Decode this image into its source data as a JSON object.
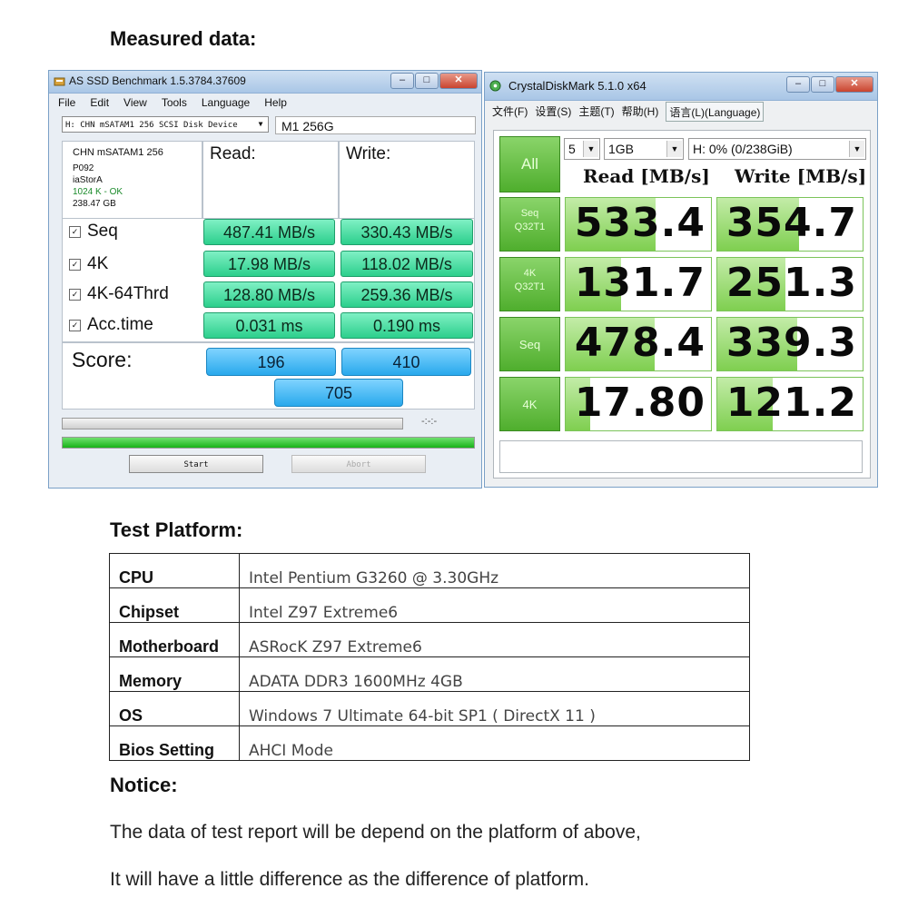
{
  "headings": {
    "measured": "Measured data:",
    "platform": "Test Platform:",
    "notice": "Notice:"
  },
  "asssd": {
    "title": "AS SSD Benchmark 1.5.3784.37609",
    "menu": [
      "File",
      "Edit",
      "View",
      "Tools",
      "Language",
      "Help"
    ],
    "drive_select": "H: CHN mSATAM1 256 SCSI Disk Device",
    "drive_name": "M1 256G",
    "info": {
      "model": "CHN mSATAM1 256",
      "firmware": "P092",
      "driver": "iaStorA",
      "align": "1024 K - OK",
      "size": "238.47 GB"
    },
    "headers": {
      "read": "Read:",
      "write": "Write:"
    },
    "rows": [
      {
        "label": "Seq",
        "read": "487.41 MB/s",
        "write": "330.43 MB/s"
      },
      {
        "label": "4K",
        "read": "17.98 MB/s",
        "write": "118.02 MB/s"
      },
      {
        "label": "4K-64Thrd",
        "read": "128.80 MB/s",
        "write": "259.36 MB/s"
      },
      {
        "label": "Acc.time",
        "read": "0.031 ms",
        "write": "0.190 ms"
      }
    ],
    "score_label": "Score:",
    "score": {
      "read": "196",
      "write": "410",
      "total": "705"
    },
    "timer": "-:-:-",
    "progress": 1.0,
    "start_label": "Start",
    "abort_label": "Abort"
  },
  "cdm": {
    "title": "CrystalDiskMark 5.1.0 x64",
    "menu": [
      "文件(F)",
      "设置(S)",
      "主题(T)",
      "帮助(H)",
      "语言(L)(Language)"
    ],
    "all_label": "All",
    "count": "5",
    "size": "1GB",
    "drive": "H: 0% (0/238GiB)",
    "headers": {
      "read": "Read [MB/s]",
      "write": "Write [MB/s]"
    },
    "rows": [
      {
        "line1": "Seq",
        "line2": "Q32T1",
        "read": "533.4",
        "write": "354.7",
        "read_level": 0.62,
        "write_level": 0.56
      },
      {
        "line1": "4K",
        "line2": "Q32T1",
        "read": "131.7",
        "write": "251.3",
        "read_level": 0.38,
        "write_level": 0.47
      },
      {
        "line1": "Seq",
        "line2": "",
        "read": "478.4",
        "write": "339.3",
        "read_level": 0.61,
        "write_level": 0.55
      },
      {
        "line1": "4K",
        "line2": "",
        "read": "17.80",
        "write": "121.2",
        "read_level": 0.17,
        "write_level": 0.38
      }
    ]
  },
  "platform": [
    {
      "key": "CPU",
      "value": "Intel Pentium G3260 @ 3.30GHz"
    },
    {
      "key": "Chipset",
      "value": "Intel Z97 Extreme6"
    },
    {
      "key": "Motherboard",
      "value": "ASRocK Z97 Extreme6"
    },
    {
      "key": "Memory",
      "value": "ADATA DDR3 1600MHz 4GB"
    },
    {
      "key": "OS",
      "value": "Windows 7 Ultimate 64-bit SP1 ( DirectX 11 )"
    },
    {
      "key": "Bios Setting",
      "value": "AHCI Mode"
    }
  ],
  "notice_lines": [
    "The data of test report will be depend on the platform of above,",
    "It will have a little difference as the difference of platform."
  ]
}
